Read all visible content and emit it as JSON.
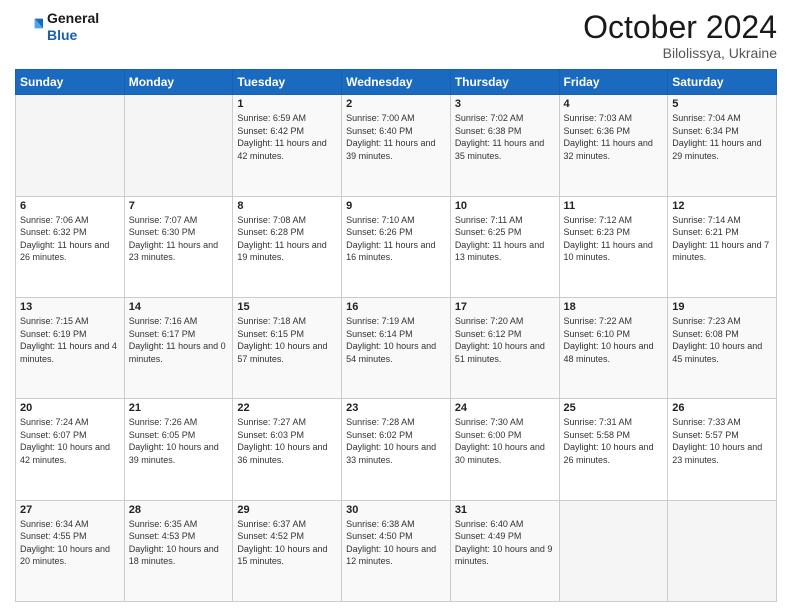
{
  "header": {
    "logo": {
      "general": "General",
      "blue": "Blue"
    },
    "month": "October 2024",
    "location": "Bilolissya, Ukraine"
  },
  "days_of_week": [
    "Sunday",
    "Monday",
    "Tuesday",
    "Wednesday",
    "Thursday",
    "Friday",
    "Saturday"
  ],
  "weeks": [
    [
      {
        "day": "",
        "content": ""
      },
      {
        "day": "",
        "content": ""
      },
      {
        "day": "1",
        "content": "Sunrise: 6:59 AM\nSunset: 6:42 PM\nDaylight: 11 hours and 42 minutes."
      },
      {
        "day": "2",
        "content": "Sunrise: 7:00 AM\nSunset: 6:40 PM\nDaylight: 11 hours and 39 minutes."
      },
      {
        "day": "3",
        "content": "Sunrise: 7:02 AM\nSunset: 6:38 PM\nDaylight: 11 hours and 35 minutes."
      },
      {
        "day": "4",
        "content": "Sunrise: 7:03 AM\nSunset: 6:36 PM\nDaylight: 11 hours and 32 minutes."
      },
      {
        "day": "5",
        "content": "Sunrise: 7:04 AM\nSunset: 6:34 PM\nDaylight: 11 hours and 29 minutes."
      }
    ],
    [
      {
        "day": "6",
        "content": "Sunrise: 7:06 AM\nSunset: 6:32 PM\nDaylight: 11 hours and 26 minutes."
      },
      {
        "day": "7",
        "content": "Sunrise: 7:07 AM\nSunset: 6:30 PM\nDaylight: 11 hours and 23 minutes."
      },
      {
        "day": "8",
        "content": "Sunrise: 7:08 AM\nSunset: 6:28 PM\nDaylight: 11 hours and 19 minutes."
      },
      {
        "day": "9",
        "content": "Sunrise: 7:10 AM\nSunset: 6:26 PM\nDaylight: 11 hours and 16 minutes."
      },
      {
        "day": "10",
        "content": "Sunrise: 7:11 AM\nSunset: 6:25 PM\nDaylight: 11 hours and 13 minutes."
      },
      {
        "day": "11",
        "content": "Sunrise: 7:12 AM\nSunset: 6:23 PM\nDaylight: 11 hours and 10 minutes."
      },
      {
        "day": "12",
        "content": "Sunrise: 7:14 AM\nSunset: 6:21 PM\nDaylight: 11 hours and 7 minutes."
      }
    ],
    [
      {
        "day": "13",
        "content": "Sunrise: 7:15 AM\nSunset: 6:19 PM\nDaylight: 11 hours and 4 minutes."
      },
      {
        "day": "14",
        "content": "Sunrise: 7:16 AM\nSunset: 6:17 PM\nDaylight: 11 hours and 0 minutes."
      },
      {
        "day": "15",
        "content": "Sunrise: 7:18 AM\nSunset: 6:15 PM\nDaylight: 10 hours and 57 minutes."
      },
      {
        "day": "16",
        "content": "Sunrise: 7:19 AM\nSunset: 6:14 PM\nDaylight: 10 hours and 54 minutes."
      },
      {
        "day": "17",
        "content": "Sunrise: 7:20 AM\nSunset: 6:12 PM\nDaylight: 10 hours and 51 minutes."
      },
      {
        "day": "18",
        "content": "Sunrise: 7:22 AM\nSunset: 6:10 PM\nDaylight: 10 hours and 48 minutes."
      },
      {
        "day": "19",
        "content": "Sunrise: 7:23 AM\nSunset: 6:08 PM\nDaylight: 10 hours and 45 minutes."
      }
    ],
    [
      {
        "day": "20",
        "content": "Sunrise: 7:24 AM\nSunset: 6:07 PM\nDaylight: 10 hours and 42 minutes."
      },
      {
        "day": "21",
        "content": "Sunrise: 7:26 AM\nSunset: 6:05 PM\nDaylight: 10 hours and 39 minutes."
      },
      {
        "day": "22",
        "content": "Sunrise: 7:27 AM\nSunset: 6:03 PM\nDaylight: 10 hours and 36 minutes."
      },
      {
        "day": "23",
        "content": "Sunrise: 7:28 AM\nSunset: 6:02 PM\nDaylight: 10 hours and 33 minutes."
      },
      {
        "day": "24",
        "content": "Sunrise: 7:30 AM\nSunset: 6:00 PM\nDaylight: 10 hours and 30 minutes."
      },
      {
        "day": "25",
        "content": "Sunrise: 7:31 AM\nSunset: 5:58 PM\nDaylight: 10 hours and 26 minutes."
      },
      {
        "day": "26",
        "content": "Sunrise: 7:33 AM\nSunset: 5:57 PM\nDaylight: 10 hours and 23 minutes."
      }
    ],
    [
      {
        "day": "27",
        "content": "Sunrise: 6:34 AM\nSunset: 4:55 PM\nDaylight: 10 hours and 20 minutes."
      },
      {
        "day": "28",
        "content": "Sunrise: 6:35 AM\nSunset: 4:53 PM\nDaylight: 10 hours and 18 minutes."
      },
      {
        "day": "29",
        "content": "Sunrise: 6:37 AM\nSunset: 4:52 PM\nDaylight: 10 hours and 15 minutes."
      },
      {
        "day": "30",
        "content": "Sunrise: 6:38 AM\nSunset: 4:50 PM\nDaylight: 10 hours and 12 minutes."
      },
      {
        "day": "31",
        "content": "Sunrise: 6:40 AM\nSunset: 4:49 PM\nDaylight: 10 hours and 9 minutes."
      },
      {
        "day": "",
        "content": ""
      },
      {
        "day": "",
        "content": ""
      }
    ]
  ]
}
